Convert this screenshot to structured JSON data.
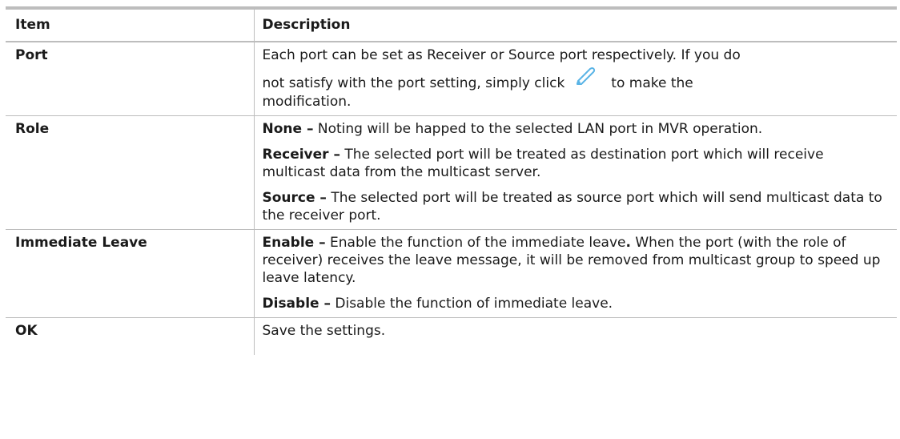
{
  "header": {
    "item": "Item",
    "description": "Description"
  },
  "rows": [
    {
      "item": "Port",
      "port_text_1": "Each port can be set as Receiver or Source port respectively. If you do",
      "port_text_2": "not satisfy with the port setting, simply click",
      "port_text_3": "to make the",
      "port_text_4": "modification.",
      "icon": "pencil-edit-icon",
      "icon_color": "#5ab4e6"
    },
    {
      "item": "Role",
      "entries": [
        {
          "term": "None –",
          "text": " Noting will be happed to the selected LAN port in MVR operation."
        },
        {
          "term": "Receiver –",
          "text": " The selected port will be treated as destination port which will receive multicast data from the multicast server."
        },
        {
          "term": "Source –",
          "text": " The selected port will be treated as source port which will send multicast data to the receiver port."
        }
      ]
    },
    {
      "item": "Immediate Leave",
      "entries": [
        {
          "term": "Enable –",
          "text_a": " Enable the function of the immediate leave",
          "text_b": " When the port (with the role of receiver) receives the leave message, it will be removed from multicast group to speed up leave latency."
        },
        {
          "term": "Disable –",
          "text": " Disable the function of immediate leave."
        }
      ]
    },
    {
      "item": "OK",
      "description": "Save the settings."
    }
  ]
}
